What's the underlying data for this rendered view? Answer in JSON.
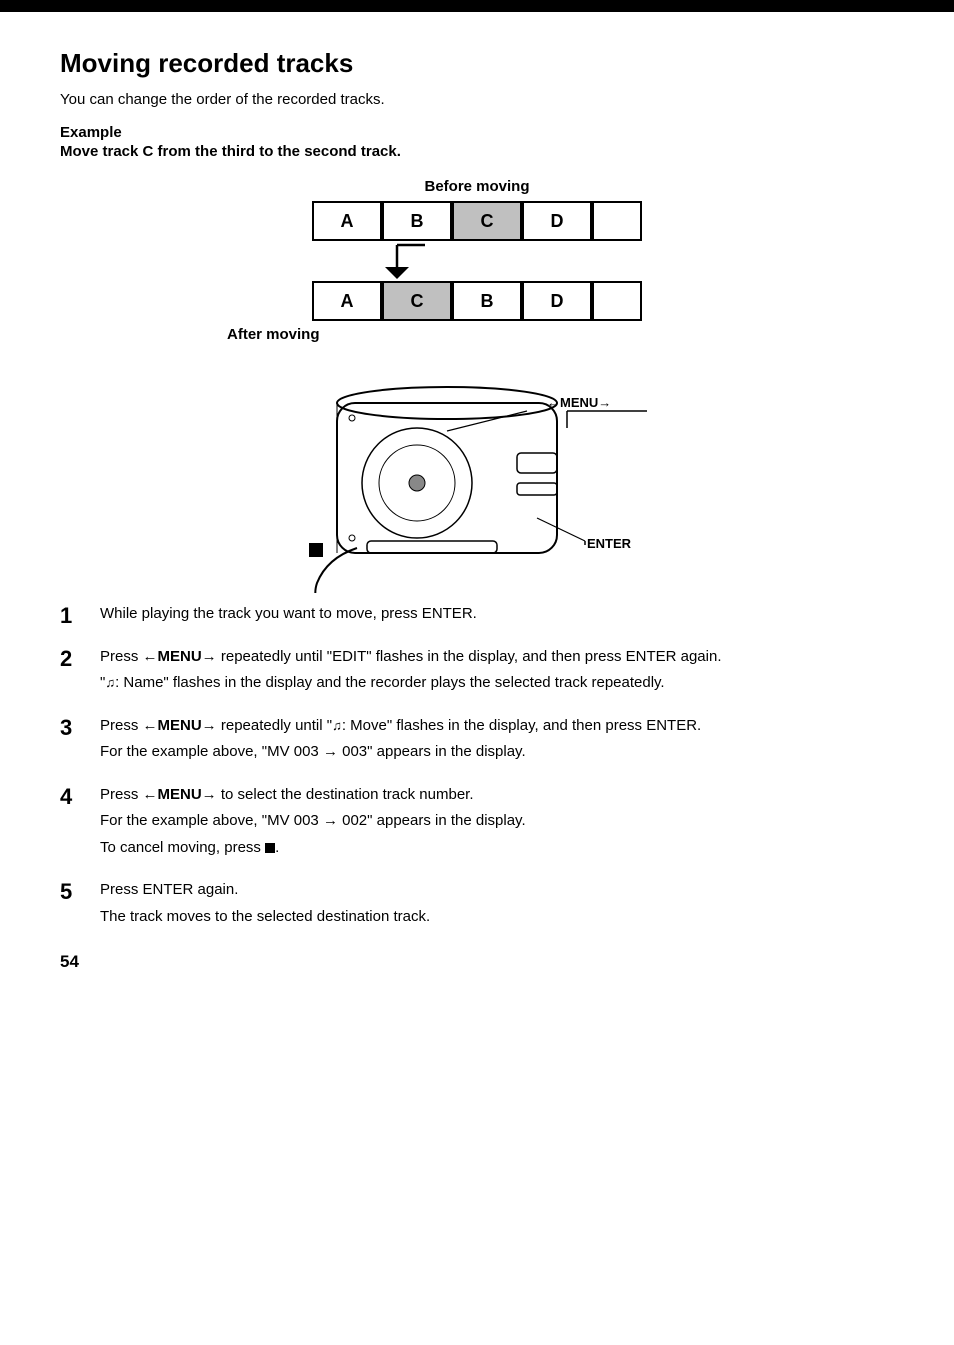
{
  "page": {
    "top_bar": true,
    "title": "Moving recorded tracks",
    "intro": "You can change the order of the recorded tracks.",
    "example_label": "Example",
    "example_subtitle": "Move track C from the third to the second track.",
    "before_label": "Before moving",
    "after_label": "After moving",
    "before_tracks": [
      "A",
      "B",
      "C",
      "D",
      ""
    ],
    "before_shaded": [
      2
    ],
    "after_tracks": [
      "A",
      "C",
      "B",
      "D",
      ""
    ],
    "after_shaded": [
      1
    ],
    "steps": [
      {
        "number": "1",
        "lines": [
          "While playing the track you want to move, press ENTER."
        ]
      },
      {
        "number": "2",
        "lines": [
          "Press ←MENU→ repeatedly until “EDIT” flashes in the display, and then press ENTER again.",
          "“♫: Name” flashes in the display and the recorder plays the selected track repeatedly."
        ]
      },
      {
        "number": "3",
        "lines": [
          "Press ←MENU→ repeatedly until “♫: Move” flashes in the display, and then press ENTER.",
          "For the example above, “MV 003 → 003” appears in the display."
        ]
      },
      {
        "number": "4",
        "lines": [
          "Press ←MENU→ to select the destination track number.",
          "For the example above, “MV 003 → 002” appears in the display.",
          "To cancel moving, press ■."
        ]
      },
      {
        "number": "5",
        "lines": [
          "Press ENTER again.",
          "The track moves to the selected destination track."
        ]
      }
    ],
    "page_number": "54",
    "labels": {
      "menu": "←MENU→",
      "enter": "ENTER"
    }
  }
}
